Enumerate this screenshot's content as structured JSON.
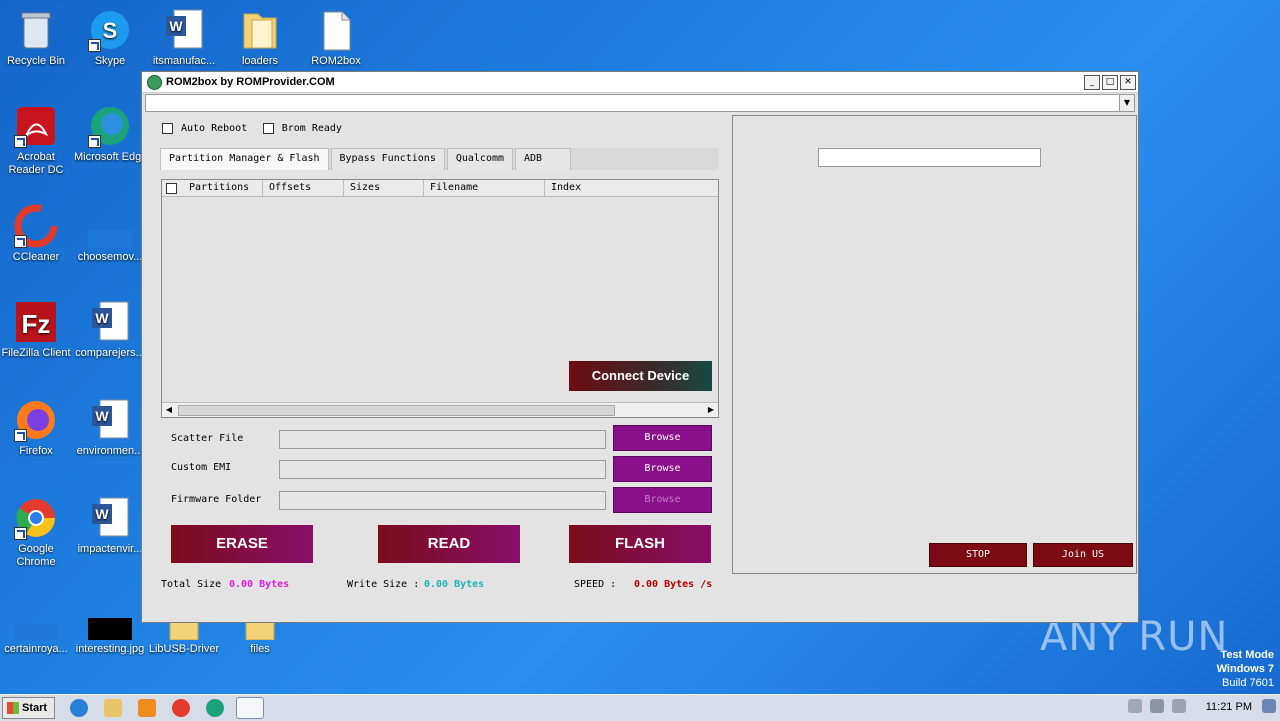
{
  "desktop": {
    "icons": [
      {
        "label": "Recycle Bin"
      },
      {
        "label": "Skype"
      },
      {
        "label": "itsmanufac..."
      },
      {
        "label": "loaders"
      },
      {
        "label": "ROM2box"
      },
      {
        "label": "Acrobat Reader DC"
      },
      {
        "label": "Microsoft Edge"
      },
      {
        "label": "CCleaner"
      },
      {
        "label": "choosemov..."
      },
      {
        "label": "FileZilla Client"
      },
      {
        "label": "comparejers..."
      },
      {
        "label": "Firefox"
      },
      {
        "label": "environmen..."
      },
      {
        "label": "Google Chrome"
      },
      {
        "label": "impactenvir..."
      },
      {
        "label": "certainroya..."
      },
      {
        "label": "interesting.jpg"
      },
      {
        "label": "LibUSB-Driver"
      },
      {
        "label": "files"
      }
    ],
    "watermark": "ANY RUN",
    "test_mode": {
      "line1": "Test Mode",
      "line2": "Windows 7",
      "line3": "Build 7601"
    }
  },
  "window": {
    "title": "ROM2box by ROMProvider.COM",
    "checkboxes": [
      {
        "label": "Auto Reboot",
        "checked": false
      },
      {
        "label": "Brom Ready",
        "checked": false
      }
    ],
    "tabs": [
      "Partition Manager & Flash",
      "Bypass Functions",
      "Qualcomm",
      "ADB"
    ],
    "active_tab": "Partition Manager & Flash",
    "grid_columns": [
      "Partitions",
      "Offsets",
      "Sizes",
      "Filename",
      "Index"
    ],
    "connect_label": "Connect Device",
    "file_rows": [
      {
        "label": "Scatter File",
        "value": "",
        "button": "Browse"
      },
      {
        "label": "Custom EMI",
        "value": "",
        "button": "Browse"
      },
      {
        "label": "Firmware Folder",
        "value": "",
        "button": "Browse"
      }
    ],
    "actions": {
      "erase": "ERASE",
      "read": "READ",
      "flash": "FLASH"
    },
    "status": {
      "total_label": "Total Size",
      "total_value": "0.00 Bytes",
      "write_label": "Write Size :",
      "write_value": "0.00 Bytes",
      "speed_label": "SPEED :",
      "speed_value": "0.00 Bytes /s"
    },
    "right_panel": {
      "input_value": "",
      "stop": "STOP",
      "join": "Join US"
    }
  },
  "taskbar": {
    "start_label": "Start",
    "clock": "11:21 PM"
  },
  "colors": {
    "browse": "#8a0f8a",
    "action_start": "#7c0b1a",
    "action_end": "#8a0e6a",
    "total_value": "#e01ee0",
    "write_value": "#1fb5b5",
    "speed_value": "#b30000"
  }
}
